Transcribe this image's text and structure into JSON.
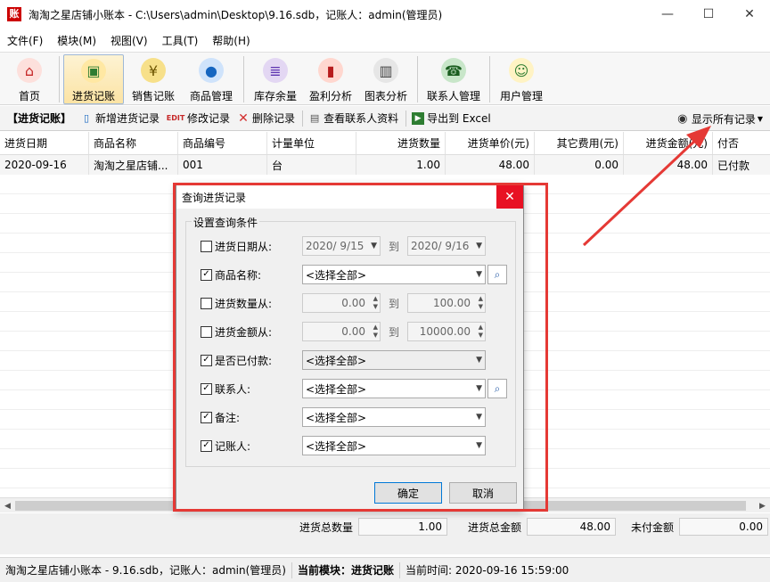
{
  "window": {
    "app_icon_text": "账",
    "title": "淘淘之星店铺小账本 - C:\\Users\\admin\\Desktop\\9.16.sdb，记账人：admin(管理员)",
    "minimize": "—",
    "maximize": "☐",
    "close": "✕"
  },
  "menu": [
    "文件(F)",
    "模块(M)",
    "视图(V)",
    "工具(T)",
    "帮助(H)"
  ],
  "toolbar": {
    "home": "首页",
    "purchase": "进货记账",
    "sales": "销售记账",
    "goods": "商品管理",
    "stock": "库存余量",
    "profit": "盈利分析",
    "charts": "图表分析",
    "contacts": "联系人管理",
    "users": "用户管理"
  },
  "subtoolbar": {
    "section": "【进货记账】",
    "add": "新增进货记录",
    "edit_badge": "EDIT",
    "edit": "修改记录",
    "delete": "删除记录",
    "view_contact": "查看联系人资料",
    "export": "导出到 Excel",
    "show_all": "显示所有记录"
  },
  "table": {
    "headers": [
      "进货日期",
      "商品名称",
      "商品编号",
      "计量单位",
      "进货数量",
      "进货单价(元)",
      "其它费用(元)",
      "进货金额(元)",
      "付否"
    ],
    "rows": [
      [
        "2020-09-16",
        "淘淘之星店铺...",
        "001",
        "台",
        "1.00",
        "48.00",
        "0.00",
        "48.00",
        "已付款"
      ]
    ]
  },
  "totals": {
    "qty_label": "进货总数量",
    "qty_value": "1.00",
    "amount_label": "进货总金额",
    "amount_value": "48.00",
    "unpaid_label": "未付金额",
    "unpaid_value": "0.00"
  },
  "status": {
    "app": "淘淘之星店铺小账本 - 9.16.sdb，记账人：admin(管理员)",
    "module": "当前模块：进货记账",
    "time": "当前时间: 2020-09-16 15:59:00"
  },
  "dialog": {
    "title": "查询进货记录",
    "group_title": "设置查询条件",
    "to": "到",
    "fields": {
      "date": {
        "label": "进货日期从:",
        "checked": false,
        "from": "2020/ 9/15",
        "to": "2020/ 9/16"
      },
      "name": {
        "label": "商品名称:",
        "checked": true,
        "value": "<选择全部>"
      },
      "qty": {
        "label": "进货数量从:",
        "checked": false,
        "from": "0.00",
        "to": "100.00"
      },
      "amount": {
        "label": "进货金额从:",
        "checked": false,
        "from": "0.00",
        "to": "10000.00"
      },
      "paid": {
        "label": "是否已付款:",
        "checked": true,
        "value": "<选择全部>"
      },
      "contact": {
        "label": "联系人:",
        "checked": true,
        "value": "<选择全部>"
      },
      "remark": {
        "label": "备注:",
        "checked": true,
        "value": "<选择全部>"
      },
      "bookkeeper": {
        "label": "记账人:",
        "checked": true,
        "value": "<选择全部>"
      }
    },
    "ok": "确定",
    "cancel": "取消"
  },
  "colors": {
    "annotation": "#e53935",
    "close_button": "#e81123"
  }
}
